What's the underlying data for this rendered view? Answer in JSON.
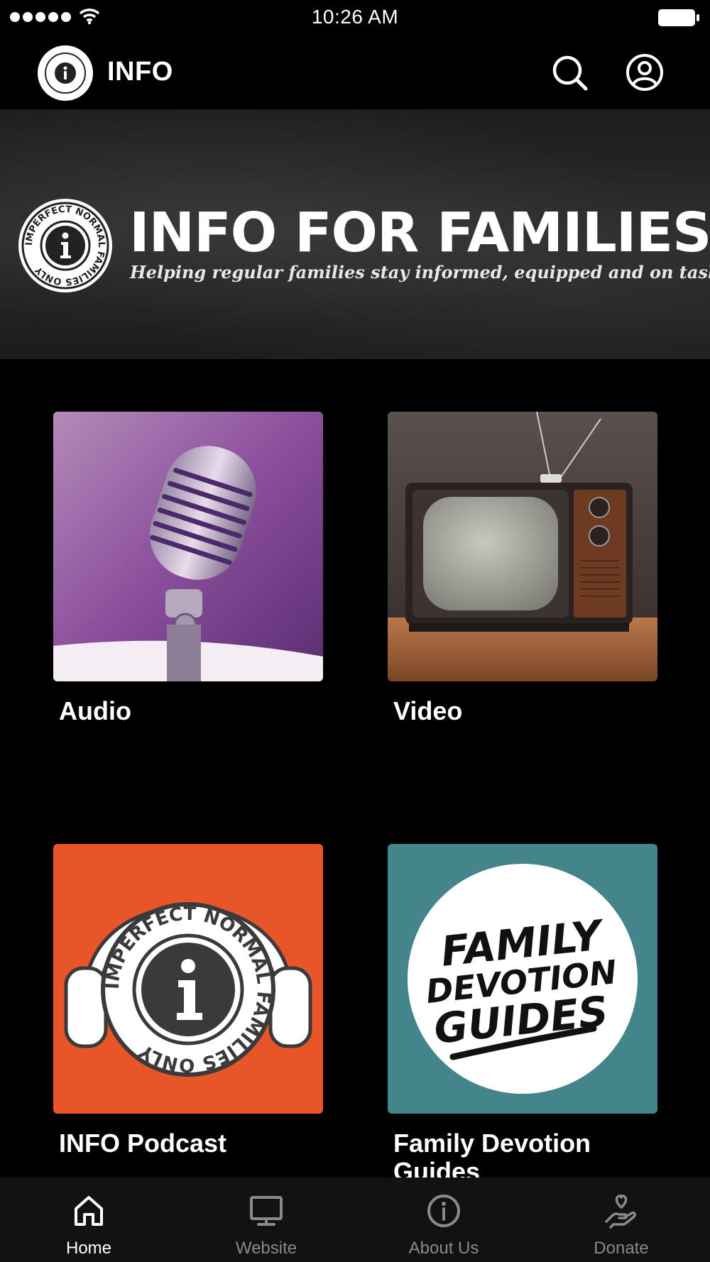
{
  "status_bar": {
    "time": "10:26 AM"
  },
  "header": {
    "title": "INFO",
    "logo_icon": "info-seal-icon"
  },
  "banner": {
    "title": "INFO FOR FAMILIES",
    "subtitle": "Helping regular families stay informed, equipped and on task",
    "seal_text": "IMPERFECT NORMAL FAMILIES ONLY"
  },
  "tiles": [
    {
      "label": "Audio",
      "image": "microphone-image"
    },
    {
      "label": "Video",
      "image": "retro-tv-image"
    },
    {
      "label": "INFO Podcast",
      "image": "podcast-headphones-image"
    },
    {
      "label": "Family Devotion Guides",
      "image": "family-devotion-guides-image"
    }
  ],
  "devotion_art": {
    "line1": "FAMILY",
    "line2": "DEVOTION",
    "line3": "GUIDES"
  },
  "bottom_nav": [
    {
      "label": "Home",
      "icon": "home-icon",
      "active": true
    },
    {
      "label": "Website",
      "icon": "monitor-icon",
      "active": false
    },
    {
      "label": "About Us",
      "icon": "info-circle-icon",
      "active": false
    },
    {
      "label": "Donate",
      "icon": "donate-hand-heart-icon",
      "active": false
    }
  ],
  "colors": {
    "background": "#000000",
    "podcast_tile": "#e85528",
    "devotion_tile": "#43858a",
    "nav_background": "#121212",
    "nav_inactive": "#8a8a8a"
  }
}
